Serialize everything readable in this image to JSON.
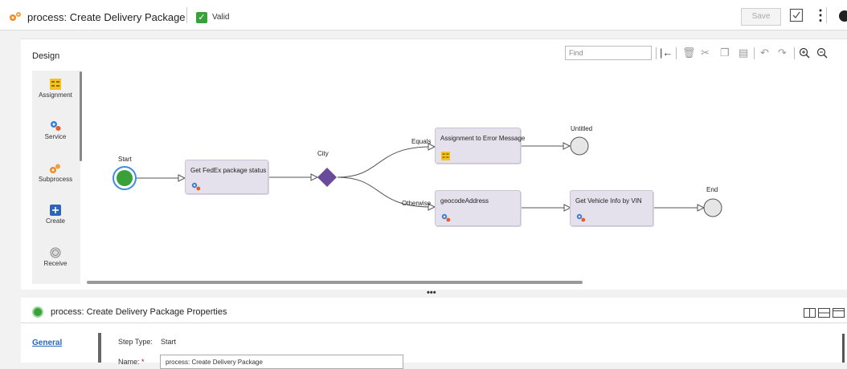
{
  "header": {
    "title": "process: Create Delivery Package",
    "valid_label": "Valid",
    "save_label": "Save"
  },
  "design": {
    "label": "Design",
    "find_placeholder": "Find"
  },
  "palette": [
    {
      "label": "Assignment",
      "icon": "assignment-icon"
    },
    {
      "label": "Service",
      "icon": "service-icon"
    },
    {
      "label": "Subprocess",
      "icon": "subprocess-icon"
    },
    {
      "label": "Create",
      "icon": "create-icon"
    },
    {
      "label": "Receive",
      "icon": "receive-icon"
    }
  ],
  "diagram": {
    "start_label": "Start",
    "city_label": "City",
    "equals_label": "Equals",
    "otherwise_label": "Otherwise",
    "untitled_label": "Untitled",
    "end_label": "End",
    "nodes": {
      "fedex": "Get FedEx package status",
      "assignment_error": "Assignment to Error Message",
      "geocode": "geocodeAddress",
      "vehicle": "Get Vehicle Info by VIN"
    }
  },
  "properties": {
    "title": "process: Create Delivery Package Properties",
    "tab_general": "General",
    "step_type_label": "Step Type:",
    "step_type_value": "Start",
    "name_label": "Name:",
    "name_required": "*",
    "name_value": "process: Create Delivery Package"
  },
  "colors": {
    "accent_green": "#3aa13a",
    "node_fill": "#e5e1ec",
    "decision": "#6a4a9a",
    "link_blue": "#2c66b8"
  }
}
